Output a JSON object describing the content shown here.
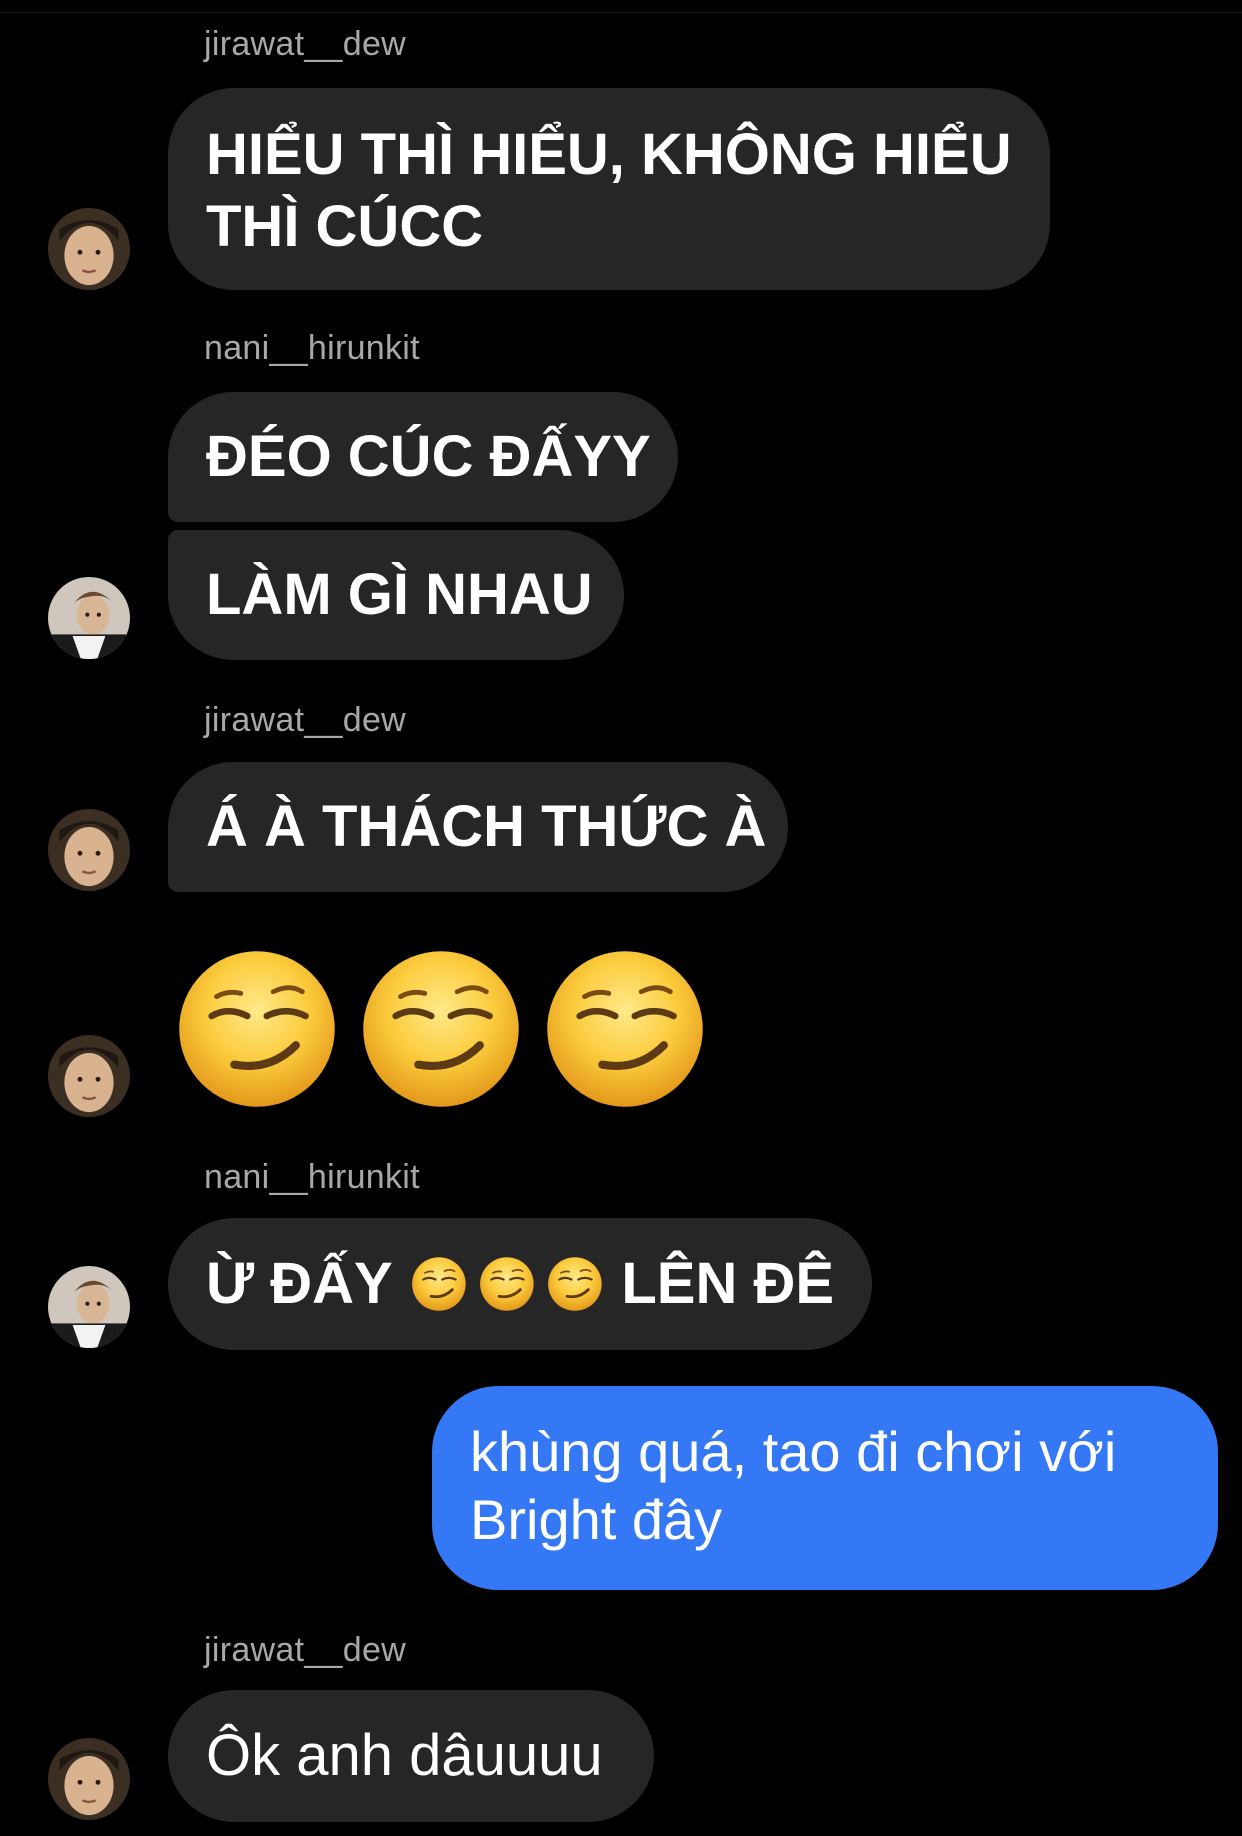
{
  "messages": [
    {
      "sender": "jirawat__dew",
      "lines": [
        "HIỂU THÌ HIỂU, KHÔNG HIỂU",
        "THÌ CÚCC"
      ]
    },
    {
      "sender": "nani__hirunkit",
      "text": "ĐÉO CÚC ĐẤYY"
    },
    {
      "text": "LÀM GÌ NHAU"
    },
    {
      "sender": "jirawat__dew",
      "text": "Á À THÁCH THỨC À"
    },
    {
      "emoji_name": "smirking-face",
      "emoji_count": 3
    },
    {
      "sender": "nani__hirunkit",
      "text_before": "Ừ ĐẤY",
      "text_after": "LÊN ĐÊ",
      "emoji_count": 3
    },
    {
      "outgoing": true,
      "lines": [
        "khùng quá, tao đi chơi với",
        "Bright đây"
      ]
    },
    {
      "sender": "jirawat__dew",
      "text": "Ôk anh dâuuuu"
    }
  ],
  "colors": {
    "background": "#000000",
    "incoming_bubble": "#262626",
    "outgoing_bubble": "#3478f6",
    "sender_name": "#a8a8a8",
    "text": "#ffffff"
  }
}
